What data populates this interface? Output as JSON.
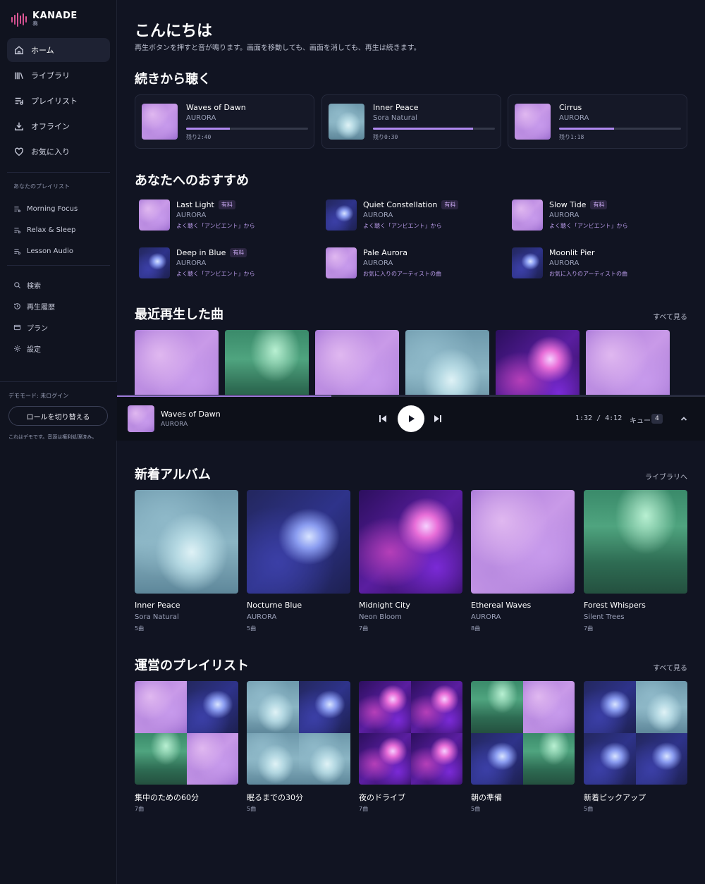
{
  "app": {
    "name": "KANADE",
    "sub": "奏"
  },
  "nav": [
    {
      "label": "ホーム",
      "icon": "home-icon"
    },
    {
      "label": "ライブラリ",
      "icon": "library-icon"
    },
    {
      "label": "プレイリスト",
      "icon": "playlist-icon"
    },
    {
      "label": "オフライン",
      "icon": "download-icon"
    },
    {
      "label": "お気に入り",
      "icon": "heart-icon"
    }
  ],
  "my_playlists": {
    "header": "あなたのプレイリスト",
    "items": [
      "Morning Focus",
      "Relax & Sleep",
      "Lesson Audio"
    ]
  },
  "utility": [
    {
      "label": "検索",
      "icon": "search-icon"
    },
    {
      "label": "再生履歴",
      "icon": "history-icon"
    },
    {
      "label": "プラン",
      "icon": "card-icon"
    },
    {
      "label": "設定",
      "icon": "gear-icon"
    }
  ],
  "demo": {
    "mode": "デモモード: 未ログイン",
    "role_button": "ロールを切り替える",
    "note": "これはデモです。音源は権利処理済み。"
  },
  "greeting": {
    "title": "こんにちは",
    "subtitle": "再生ボタンを押すと音が鳴ります。画面を移動しても、画面を消しても、再生は続きます。"
  },
  "continue": {
    "heading": "続きから聴く",
    "items": [
      {
        "title": "Waves of Dawn",
        "artist": "AURORA",
        "remaining": "残り2:40",
        "progress": 0.36,
        "art": "purple"
      },
      {
        "title": "Inner Peace",
        "artist": "Sora Natural",
        "remaining": "残り0:30",
        "progress": 0.82,
        "art": "teal"
      },
      {
        "title": "Cirrus",
        "artist": "AURORA",
        "remaining": "残り1:18",
        "progress": 0.45,
        "art": "purple"
      }
    ]
  },
  "recommend": {
    "heading": "あなたへのおすすめ",
    "items": [
      {
        "title": "Last Light",
        "paid": "有料",
        "artist": "AURORA",
        "reason": "よく聴く「アンビエント」から",
        "art": "purple"
      },
      {
        "title": "Quiet Constellation",
        "paid": "有料",
        "artist": "AURORA",
        "reason": "よく聴く「アンビエント」から",
        "art": "blue"
      },
      {
        "title": "Slow Tide",
        "paid": "有料",
        "artist": "AURORA",
        "reason": "よく聴く「アンビエント」から",
        "art": "purple"
      },
      {
        "title": "Deep in Blue",
        "paid": "有料",
        "artist": "AURORA",
        "reason": "よく聴く「アンビエント」から",
        "art": "blue"
      },
      {
        "title": "Pale Aurora",
        "paid": "",
        "artist": "AURORA",
        "reason": "お気に入りのアーティストの曲",
        "art": "purple"
      },
      {
        "title": "Moonlit Pier",
        "paid": "",
        "artist": "AURORA",
        "reason": "お気に入りのアーティストの曲",
        "art": "blue"
      }
    ]
  },
  "recent": {
    "heading": "最近再生した曲",
    "see_all": "すべて見る",
    "arts": [
      "purple",
      "green",
      "purple",
      "teal",
      "neon",
      "purple"
    ]
  },
  "player": {
    "title": "Waves of Dawn",
    "artist": "AURORA",
    "time": "1:32 / 4:12",
    "queue_label": "キュー",
    "queue_count": "4",
    "progress": 0.365,
    "art": "purple"
  },
  "albums": {
    "heading": "新着アルバム",
    "see_all": "ライブラリへ",
    "items": [
      {
        "title": "Inner Peace",
        "artist": "Sora Natural",
        "count": "5曲",
        "art": "teal"
      },
      {
        "title": "Nocturne Blue",
        "artist": "AURORA",
        "count": "5曲",
        "art": "blue"
      },
      {
        "title": "Midnight City",
        "artist": "Neon Bloom",
        "count": "7曲",
        "art": "neon"
      },
      {
        "title": "Ethereal Waves",
        "artist": "AURORA",
        "count": "8曲",
        "art": "purple"
      },
      {
        "title": "Forest Whispers",
        "artist": "Silent Trees",
        "count": "7曲",
        "art": "green"
      }
    ]
  },
  "playlists": {
    "heading": "運営のプレイリスト",
    "see_all": "すべて見る",
    "items": [
      {
        "name": "集中のための60分",
        "count": "7曲",
        "arts": [
          "purple",
          "blue",
          "green",
          "purple"
        ]
      },
      {
        "name": "眠るまでの30分",
        "count": "5曲",
        "arts": [
          "teal",
          "blue",
          "teal",
          "teal"
        ]
      },
      {
        "name": "夜のドライブ",
        "count": "7曲",
        "arts": [
          "neon",
          "neon",
          "neon",
          "neon"
        ]
      },
      {
        "name": "朝の準備",
        "count": "5曲",
        "arts": [
          "green",
          "purple",
          "blue",
          "green"
        ]
      },
      {
        "name": "新着ピックアップ",
        "count": "5曲",
        "arts": [
          "blue",
          "teal",
          "blue",
          "blue"
        ]
      }
    ]
  }
}
